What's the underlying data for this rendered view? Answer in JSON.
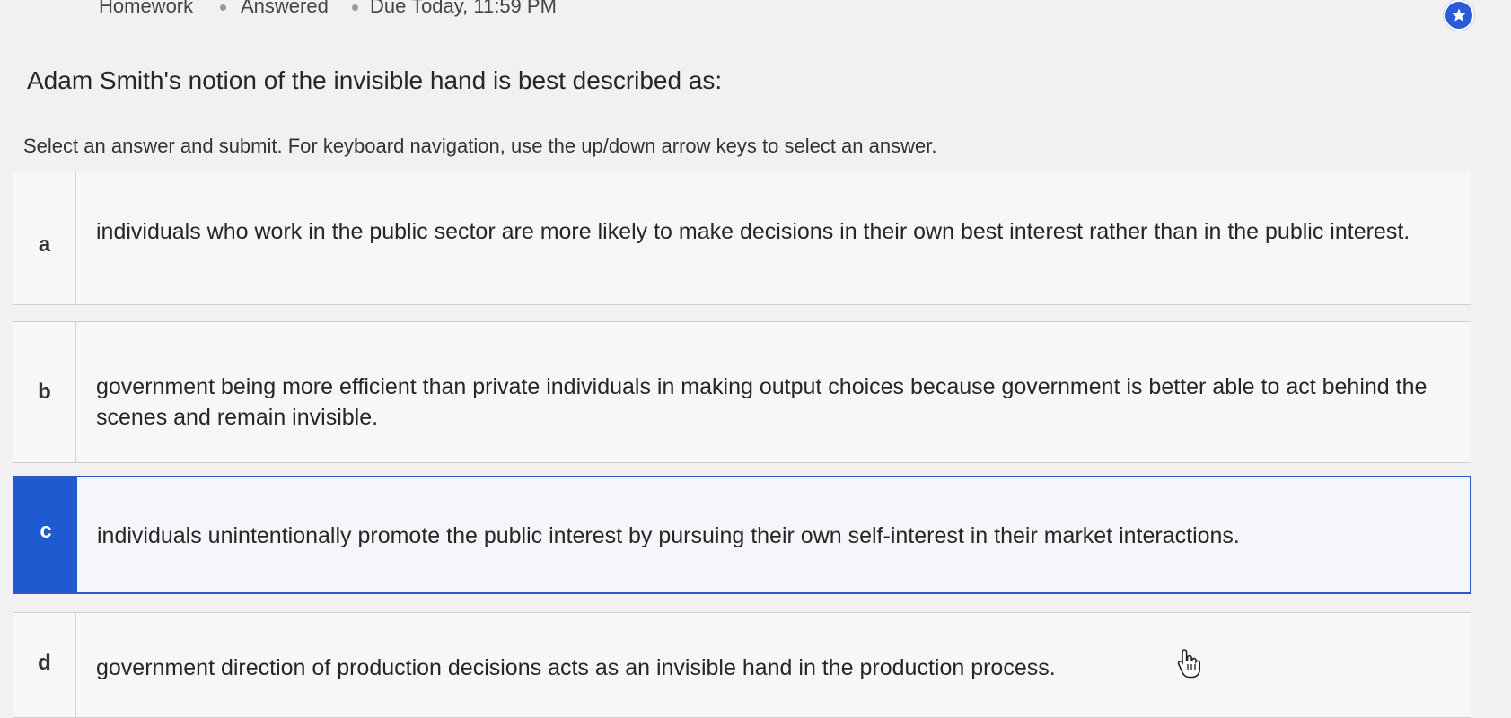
{
  "header": {
    "crumb1": "Homework",
    "crumb2": "Answered",
    "due": "Due Today, 11:59 PM",
    "star_icon": "star-icon"
  },
  "question": {
    "prompt": "Adam Smith's notion of the invisible hand is best described as:",
    "instructions": "Select an answer and submit. For keyboard navigation, use the up/down arrow keys to select an answer."
  },
  "choices": [
    {
      "letter": "a",
      "text": "individuals who work in the public sector are more likely to make decisions in their own best interest rather than in the public interest.",
      "selected": false
    },
    {
      "letter": "b",
      "text": "government being more efficient than private individuals in making output choices because government is better able to act behind the scenes and remain invisible.",
      "selected": false
    },
    {
      "letter": "c",
      "text": "individuals unintentionally promote the public interest by pursuing their own self-interest in their market interactions.",
      "selected": true
    },
    {
      "letter": "d",
      "text": "government direction of production decisions acts as an invisible hand in the production process.",
      "selected": false
    }
  ],
  "colors": {
    "accent": "#1f5ad1",
    "background": "#f1f1f1"
  }
}
